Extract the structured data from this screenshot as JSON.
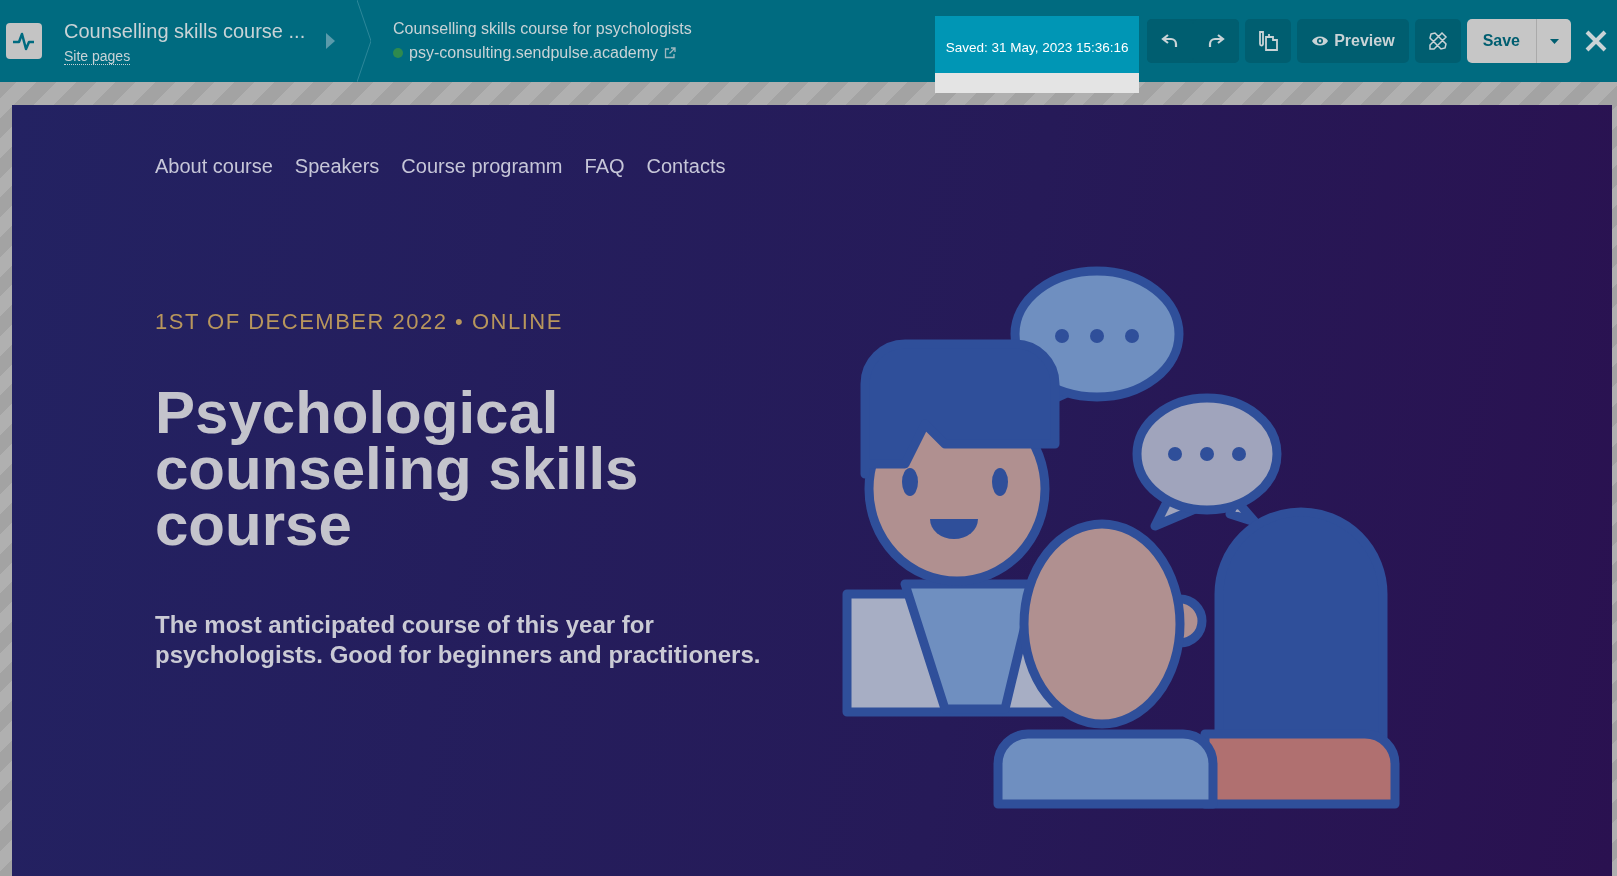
{
  "header": {
    "site_title": "Counselling skills course ...",
    "site_pages_link": "Site pages",
    "page_title": "Counselling skills course for psychologists",
    "domain": "psy-consulting.sendpulse.academy",
    "saved_status": "Saved: 31 May, 2023 15:36:16",
    "preview_label": "Preview",
    "save_label": "Save"
  },
  "page": {
    "nav": [
      "About course",
      "Speakers",
      "Course programm",
      "FAQ",
      "Contacts"
    ],
    "eyebrow": "1ST OF DECEMBER 2022 • ONLINE",
    "title": "Psychological counseling skills course",
    "subtitle": "The most anticipated course of this year for psychologists. Good for beginners and practitioners."
  }
}
